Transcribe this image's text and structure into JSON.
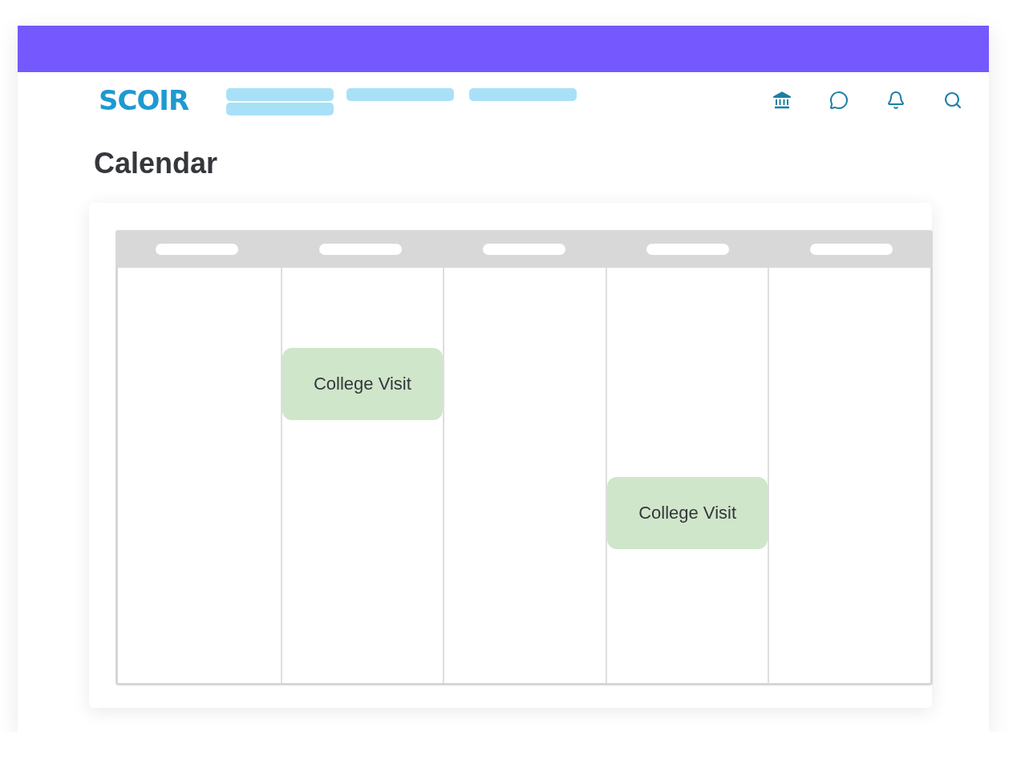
{
  "logo": "SCOIR",
  "nav": [
    {
      "kind": "two-line"
    },
    {
      "kind": "one-line"
    },
    {
      "kind": "one-line"
    }
  ],
  "title": "Calendar",
  "calendar": {
    "days": [
      {
        "kind": "empty"
      },
      {
        "kind": "event",
        "event": "College Visit"
      },
      {
        "kind": "empty"
      },
      {
        "kind": "event",
        "event": "College Visit"
      },
      {
        "kind": "empty"
      }
    ]
  }
}
